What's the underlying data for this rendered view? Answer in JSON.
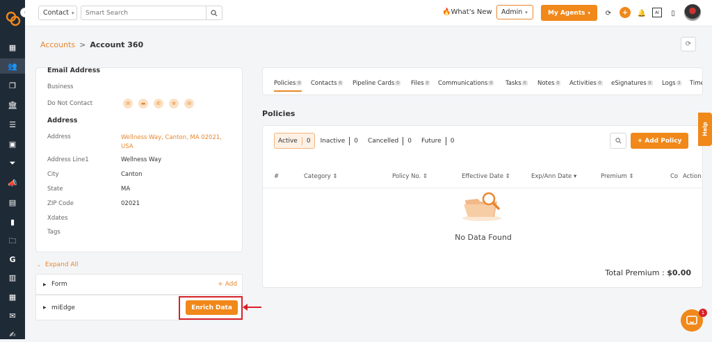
{
  "topbar": {
    "entity_select": "Contact",
    "search_placeholder": "Smart Search",
    "whats_new": "What's New",
    "role_select": "Admin",
    "my_agents": "My Agents",
    "notification_badge": "+"
  },
  "breadcrumb": {
    "parent": "Accounts",
    "separator": ">",
    "current": "Account 360"
  },
  "contact_card": {
    "email_heading": "Email Address",
    "business_label": "Business",
    "do_not_contact_label": "Do Not Contact",
    "address_heading": "Address",
    "fields": [
      {
        "label": "Address",
        "value": "Wellness Way, Canton, MA 02021, USA"
      },
      {
        "label": "Address Line1",
        "value": "Wellness Way"
      },
      {
        "label": "City",
        "value": "Canton"
      },
      {
        "label": "State",
        "value": "MA"
      },
      {
        "label": "ZIP Code",
        "value": "02021"
      },
      {
        "label": "Xdates",
        "value": ""
      },
      {
        "label": "Tags",
        "value": ""
      }
    ]
  },
  "expand_all": "Expand All",
  "accordion": {
    "form_label": "Form",
    "add_label": "+ Add",
    "miedge_label": "miEdge",
    "enrich_button": "Enrich Data"
  },
  "tabs": [
    {
      "label": "Policies",
      "count": "0"
    },
    {
      "label": "Contacts",
      "count": "0"
    },
    {
      "label": "Pipeline Cards",
      "count": "0"
    },
    {
      "label": "Files",
      "count": "0"
    },
    {
      "label": "Communications",
      "count": "0"
    },
    {
      "label": "Tasks",
      "count": "0"
    },
    {
      "label": "Notes",
      "count": "0"
    },
    {
      "label": "Activities",
      "count": "0"
    },
    {
      "label": "eSignatures",
      "count": "0"
    },
    {
      "label": "Logs",
      "count": "3"
    },
    {
      "label": "Time",
      "count": ""
    }
  ],
  "policies": {
    "title": "Policies",
    "filters": [
      {
        "label": "Active",
        "count": "0"
      },
      {
        "label": "Inactive",
        "count": "0"
      },
      {
        "label": "Cancelled",
        "count": "0"
      },
      {
        "label": "Future",
        "count": "0"
      }
    ],
    "add_policy": "+ Add Policy",
    "columns": [
      "#",
      "Category ⇕",
      "Policy No. ⇕",
      "Effective Date ⇕",
      "Exp/Ann Date ▾",
      "Premium ⇕",
      "Co",
      "Action"
    ],
    "no_data": "No Data Found",
    "total_label": "Total Premium :",
    "total_value": "$0.00"
  },
  "help_label": "Help",
  "chat_badge": "1",
  "colors": {
    "accent": "#f0881a",
    "sidebar": "#1f2a37",
    "highlight": "#d62128"
  }
}
